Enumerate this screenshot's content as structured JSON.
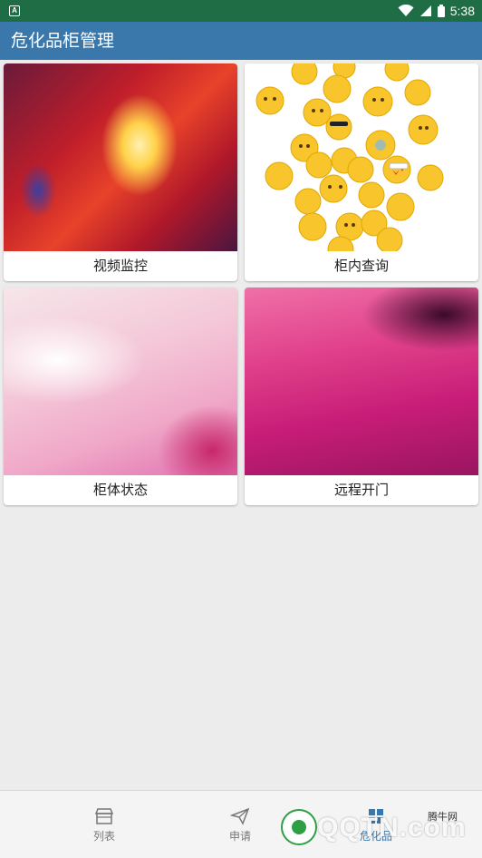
{
  "status_bar": {
    "notification_icon": "A",
    "time": "5:38",
    "icons": [
      "wifi-icon",
      "signal-icon",
      "battery-icon"
    ]
  },
  "app_bar": {
    "title": "危化品柜管理"
  },
  "tiles": [
    {
      "label": "视频监控",
      "image": "abstract-red-painting"
    },
    {
      "label": "柜内查询",
      "image": "emoji-cluster"
    },
    {
      "label": "柜体状态",
      "image": "abstract-pink-white-painting"
    },
    {
      "label": "远程开门",
      "image": "abstract-magenta-painting"
    }
  ],
  "bottom_nav": {
    "items": [
      {
        "label": "列表",
        "icon": "storefront-icon",
        "active": false
      },
      {
        "label": "申请",
        "icon": "paper-plane-icon",
        "active": false
      },
      {
        "label": "危化品",
        "icon": "grid-icon",
        "active": true
      }
    ]
  },
  "watermark": {
    "brand": "QQTN.com",
    "sub": "腾牛网"
  },
  "colors": {
    "status_bar": "#1f6d45",
    "app_bar": "#3a78ac",
    "background": "#ececec",
    "nav_active": "#3a78ac",
    "nav_inactive": "#777777"
  }
}
